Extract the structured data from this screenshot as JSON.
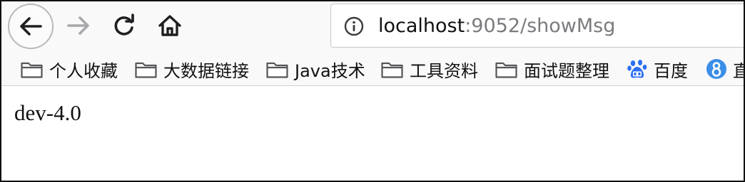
{
  "toolbar": {
    "back_icon": "arrow-left-icon",
    "forward_icon": "arrow-right-icon",
    "reload_icon": "reload-icon",
    "home_icon": "home-icon"
  },
  "urlbar": {
    "info_icon": "info-icon",
    "host": "localhost",
    "rest": ":9052/showMsg"
  },
  "bookmarks": [
    {
      "icon": "folder-icon",
      "label": "个人收藏"
    },
    {
      "icon": "folder-icon",
      "label": "大数据链接"
    },
    {
      "icon": "folder-icon",
      "label": "Java技术"
    },
    {
      "icon": "folder-icon",
      "label": "工具资料"
    },
    {
      "icon": "folder-icon",
      "label": "面试题整理"
    },
    {
      "icon": "baidu-paw-icon",
      "label": "百度"
    },
    {
      "icon": "number-8-circle-icon",
      "label": "直"
    }
  ],
  "page": {
    "body_text": "dev-4.0"
  },
  "colors": {
    "toolbar_bg": "#f9f9fa",
    "inactive_icon": "#a8a8ab",
    "baidu_blue": "#2d6ff2",
    "circle_blue": "#3b8ee8"
  }
}
